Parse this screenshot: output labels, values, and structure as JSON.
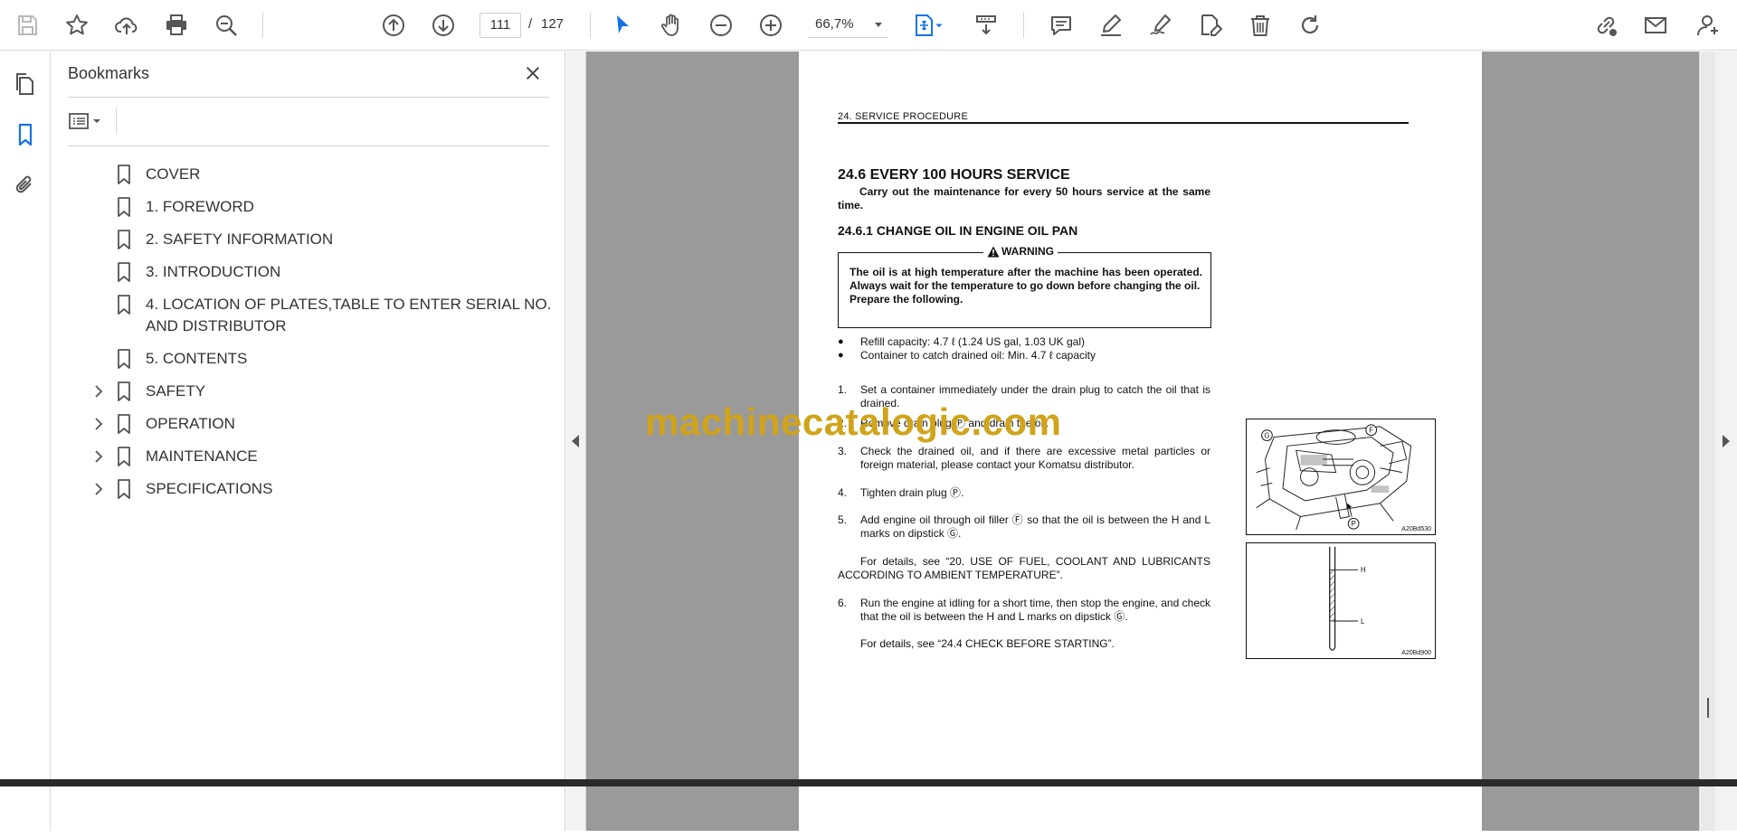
{
  "toolbar": {
    "page_current": "111",
    "page_separator": "/",
    "page_total": "127",
    "zoom": "66,7%"
  },
  "bookmarks": {
    "title": "Bookmarks",
    "items": [
      {
        "label": "COVER",
        "expandable": false
      },
      {
        "label": "1. FOREWORD",
        "expandable": false
      },
      {
        "label": "2. SAFETY INFORMATION",
        "expandable": false
      },
      {
        "label": "3. INTRODUCTION",
        "expandable": false
      },
      {
        "label": "4. LOCATION OF PLATES,TABLE TO ENTER SERIAL NO. AND DISTRIBUTOR",
        "expandable": false
      },
      {
        "label": "5. CONTENTS",
        "expandable": false
      },
      {
        "label": "SAFETY",
        "expandable": true
      },
      {
        "label": "OPERATION",
        "expandable": true
      },
      {
        "label": "MAINTENANCE",
        "expandable": true
      },
      {
        "label": "SPECIFICATIONS",
        "expandable": true
      }
    ]
  },
  "document": {
    "header": "24.  SERVICE PROCEDURE",
    "heading": "24.6  EVERY 100 HOURS SERVICE",
    "intro": "Carry out the maintenance for every 50 hours service at the same time.",
    "subheading": "24.6.1 CHANGE OIL IN ENGINE OIL PAN",
    "warning_title": "WARNING",
    "warning_text": "The oil is at high temperature after the machine has been operated. Always wait for the temperature to go down before changing the oil.",
    "warning_prepare": "Prepare the following.",
    "bullets": [
      "Refill capacity: 4.7 ℓ (1.24 US gal, 1.03 UK gal)",
      "Container to catch drained oil: Min. 4.7 ℓ capacity"
    ],
    "steps": [
      {
        "num": "1.",
        "text": "Set a container immediately under the drain plug to catch the oil that is drained."
      },
      {
        "num": "2.",
        "text": "Remove drain plug Ⓟ and drain the oil."
      },
      {
        "num": "3.",
        "text": "Check the drained oil, and if there are excessive metal particles or foreign material, please contact your Komatsu distributor."
      },
      {
        "num": "4.",
        "text": "Tighten drain plug Ⓟ."
      },
      {
        "num": "5.",
        "text": "Add engine oil through oil filler Ⓕ so that the oil is between the H and L marks on dipstick Ⓖ."
      },
      {
        "num": "6.",
        "text": "Run the engine at idling for a short time, then stop the engine, and check that the oil is between the H and L marks on dipstick Ⓖ."
      }
    ],
    "details_1": "For details, see “20. USE OF FUEL, COOLANT AND LUBRICANTS ACCORDING TO AMBIENT TEMPERATURE”.",
    "details_2": "For details, see “24.4 CHECK BEFORE STARTING”.",
    "figure_1_code": "A20Bd530",
    "figure_1_labels": {
      "g": "G",
      "f": "F",
      "p": "P"
    },
    "figure_2_code": "A20Bd900",
    "figure_2_labels": {
      "h": "H",
      "l": "L"
    }
  },
  "watermark": "machinecatalogic.com"
}
